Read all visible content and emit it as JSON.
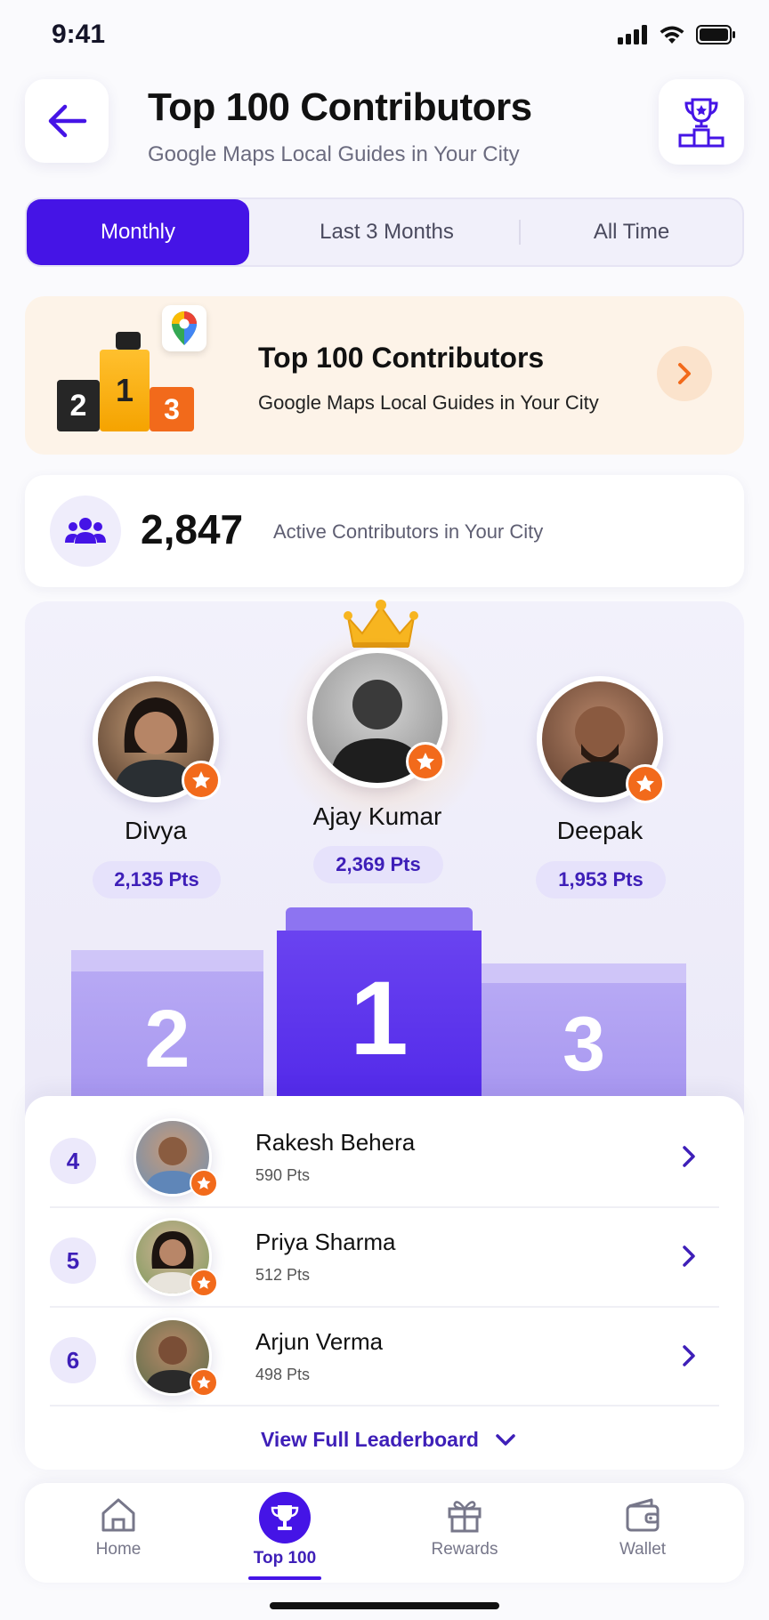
{
  "status_bar": {
    "time": "9:41"
  },
  "header": {
    "title": "Top 100 Contributors",
    "subtitle": "Google Maps Local Guides in Your City"
  },
  "tabs": [
    {
      "label": "Monthly",
      "active": true
    },
    {
      "label": "Last 3 Months",
      "active": false
    },
    {
      "label": "All Time",
      "active": false
    }
  ],
  "banner": {
    "title": "Top 100 Contributors",
    "subtitle": "Google Maps Local Guides in Your City",
    "podium_numbers": [
      "2",
      "1",
      "3"
    ]
  },
  "stats": {
    "count": "2,847",
    "label": "Active Contributors in Your City"
  },
  "podium": {
    "first": {
      "name": "Ajay Kumar",
      "points": "2,369 Pts",
      "rank": "1"
    },
    "second": {
      "name": "Divya",
      "points": "2,135 Pts",
      "rank": "2"
    },
    "third": {
      "name": "Deepak",
      "points": "1,953 Pts",
      "rank": "3"
    }
  },
  "leaderboard": {
    "rows": [
      {
        "rank": "4",
        "name": "Rakesh Behera",
        "points": "590 Pts"
      },
      {
        "rank": "5",
        "name": "Priya Sharma",
        "points": "512 Pts"
      },
      {
        "rank": "6",
        "name": "Arjun Verma",
        "points": "498 Pts"
      }
    ],
    "view_full_label": "View Full Leaderboard"
  },
  "bottom_nav": [
    {
      "label": "Home",
      "icon": "home-icon",
      "active": false
    },
    {
      "label": "Top 100",
      "icon": "trophy-icon",
      "active": true
    },
    {
      "label": "Rewards",
      "icon": "gift-icon",
      "active": false
    },
    {
      "label": "Wallet",
      "icon": "wallet-icon",
      "active": false
    }
  ],
  "colors": {
    "primary": "#4514e6",
    "accent_orange": "#f26a1b",
    "podium_light": "#b4a5f3",
    "banner_bg": "#fdf3e8"
  }
}
